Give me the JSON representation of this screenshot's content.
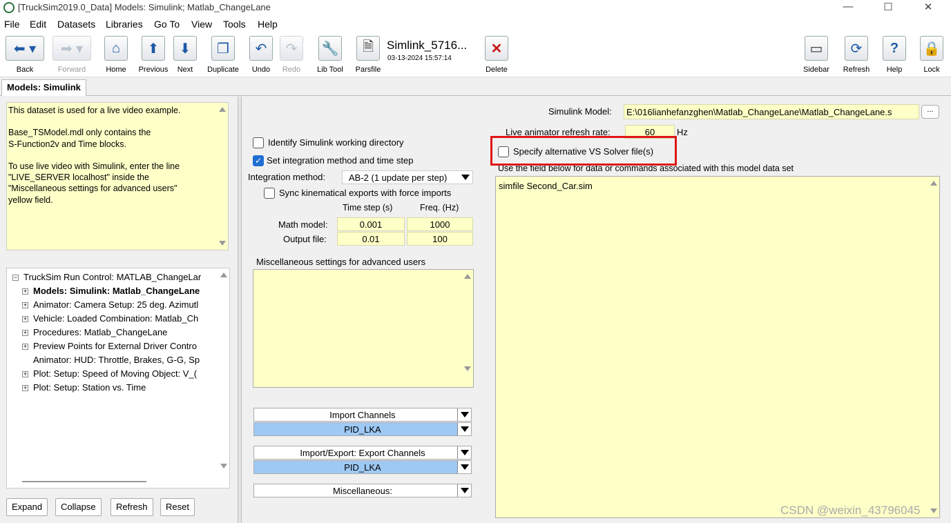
{
  "window": {
    "title": "[TruckSim2019.0_Data] Models: Simulink; Matlab_ChangeLane",
    "min_glyph": "—",
    "max_glyph": "☐",
    "close_glyph": "✕"
  },
  "menu": [
    "File",
    "Edit",
    "Datasets",
    "Libraries",
    "Go To",
    "View",
    "Tools",
    "Help"
  ],
  "toolbar": {
    "back": "Back",
    "forward": "Forward",
    "home": "Home",
    "previous": "Previous",
    "next": "Next",
    "duplicate": "Duplicate",
    "undo": "Undo",
    "redo": "Redo",
    "lib_tool": "Lib Tool",
    "parsfile": "Parsfile",
    "dataset_name": "Simlink_5716...",
    "dataset_date": "03-13-2024 15:57:14",
    "delete": "Delete",
    "sidebar": "Sidebar",
    "refresh": "Refresh",
    "help": "Help",
    "lock": "Lock"
  },
  "tab": {
    "label": "Models: Simulink"
  },
  "notes": {
    "lines": [
      "This dataset is used for a live video example.",
      "",
      "Base_TSModel.mdl only contains the",
      "S-Function2v and Time blocks.",
      "",
      "To use live video with Simulink, enter the line",
      "\"LIVE_SERVER localhost\" inside the",
      "\"Miscellaneous settings for advanced users\"",
      "yellow field."
    ]
  },
  "tree": {
    "root": "TruckSim Run Control: MATLAB_ChangeLar",
    "items": [
      "Models: Simulink: Matlab_ChangeLane",
      "Animator: Camera Setup: 25 deg. Azimutl",
      "Vehicle: Loaded Combination: Matlab_Ch",
      "Procedures: Matlab_ChangeLane",
      "Preview Points for External Driver Contro",
      "Animator: HUD: Throttle, Brakes, G-G, Sp",
      "Plot: Setup: Speed of Moving Object: V_(",
      "Plot: Setup: Station vs. Time"
    ]
  },
  "tree_buttons": {
    "expand": "Expand",
    "collapse": "Collapse",
    "refresh": "Refresh",
    "reset": "Reset"
  },
  "settings": {
    "identify_dir": "Identify Simulink working directory",
    "identify_dir_checked": false,
    "set_integration": "Set integration method and time step",
    "set_integration_checked": true,
    "integration_label": "Integration method:",
    "integration_value": "AB-2 (1 update per step)",
    "sync_label": "Sync kinematical exports with force imports",
    "sync_checked": false,
    "col_timestep": "Time step (s)",
    "col_freq": "Freq. (Hz)",
    "math_label": "Math model:",
    "math_timestep": "0.001",
    "math_freq": "1000",
    "output_label": "Output file:",
    "output_timestep": "0.01",
    "output_freq": "100",
    "misc_label": "Miscellaneous settings for advanced users",
    "import_channels": "Import Channels",
    "import_value": "PID_LKA",
    "export_channels": "Import/Export: Export Channels",
    "export_value": "PID_LKA",
    "misc_dropdown": "Miscellaneous:"
  },
  "right": {
    "simulink_model_label": "Simulink Model:",
    "simulink_model_path": "E:\\016lianhefanzghen\\Matlab_ChangeLane\\Matlab_ChangeLane.s",
    "browse_label": "...",
    "refresh_rate_label": "Live animator refresh rate:",
    "refresh_rate_value": "60",
    "refresh_rate_unit": "Hz",
    "alt_solver_label": "Specify alternative VS Solver file(s)",
    "alt_solver_checked": false,
    "field_caption": "Use the field below for data or commands associated with this model data set",
    "field_text": "simfile Second_Car.sim"
  },
  "watermark": "CSDN @weixin_43796045",
  "colors": {
    "highlight_box": "#e01515",
    "yellow": "#ffffc8",
    "selected": "#9ec9f5"
  }
}
